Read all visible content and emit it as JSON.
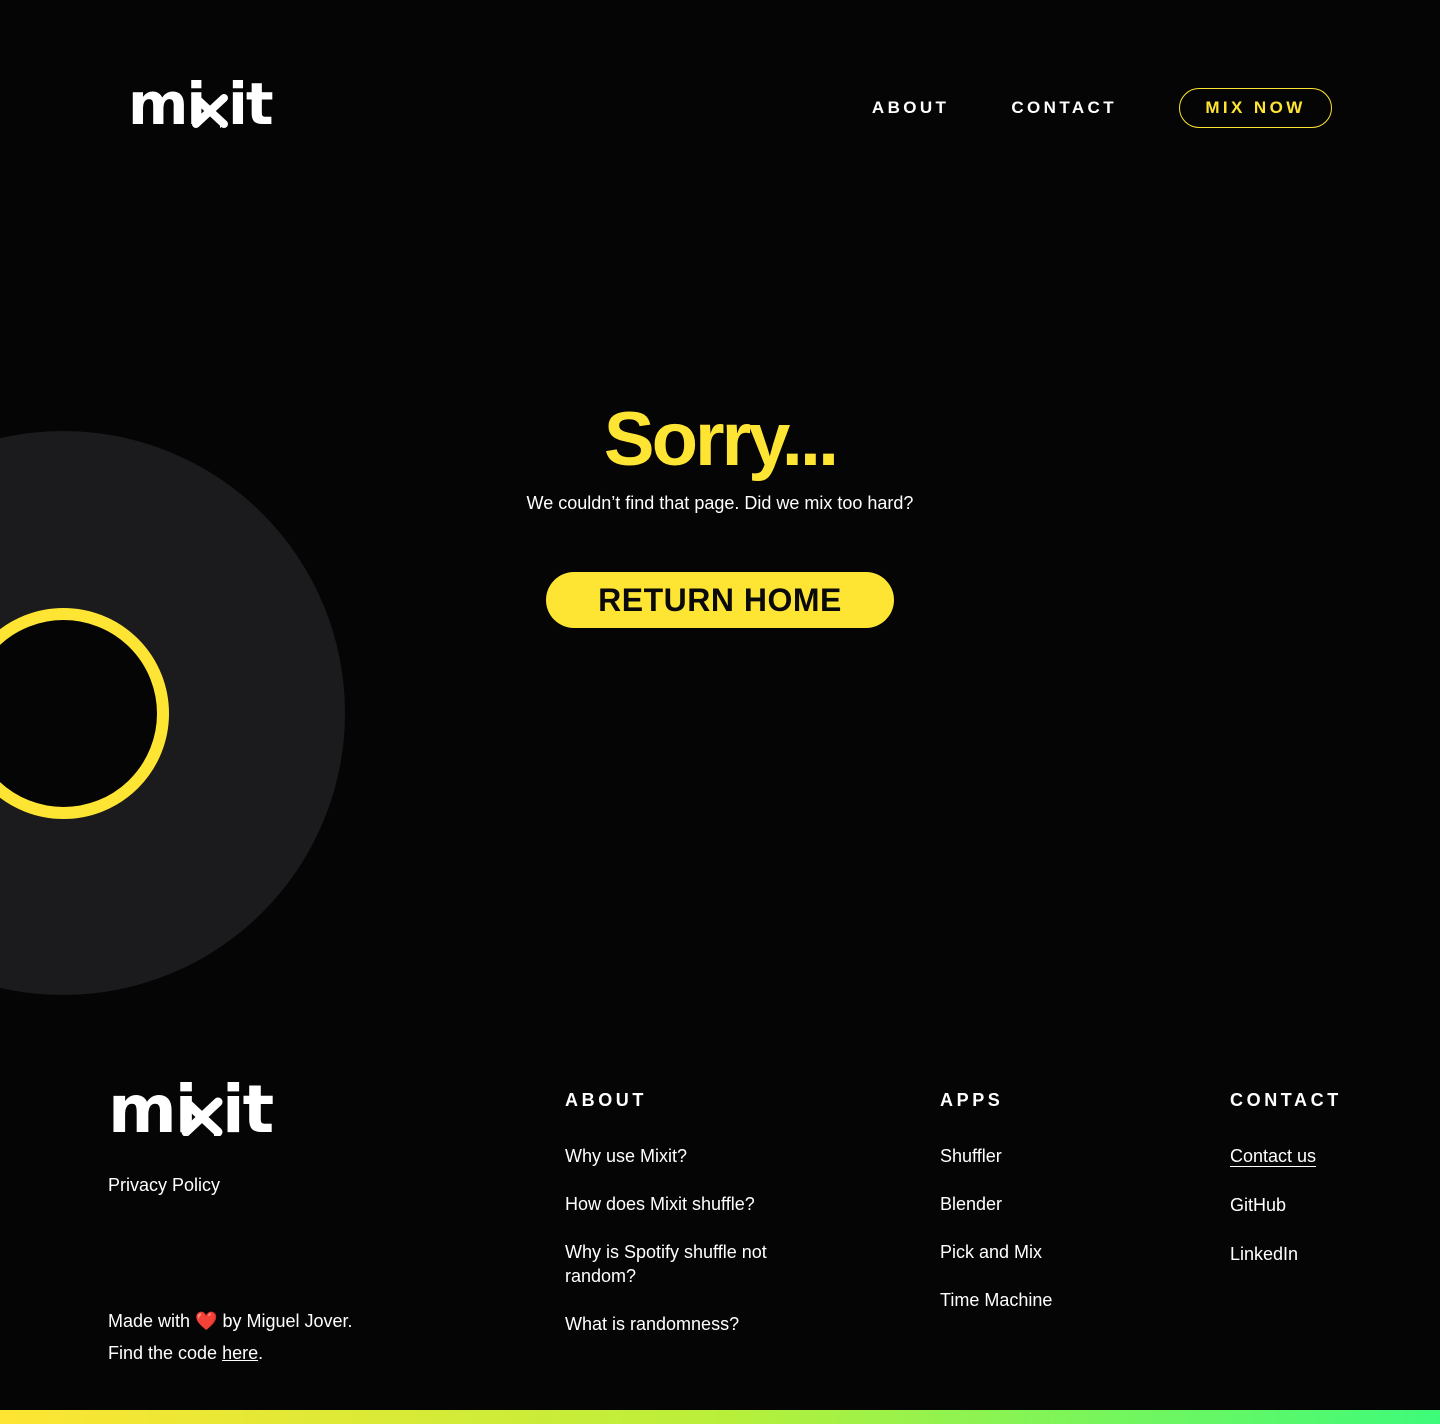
{
  "brand": {
    "name": "mixit",
    "accent": "#ffe533",
    "background": "#050505"
  },
  "header": {
    "nav": [
      {
        "label": "ABOUT"
      },
      {
        "label": "CONTACT"
      }
    ],
    "cta": "MIX NOW"
  },
  "hero": {
    "title": "Sorry...",
    "subtitle": "We couldn’t find that page. Did we mix too hard?",
    "button": "RETURN HOME"
  },
  "footer": {
    "privacy": "Privacy Policy",
    "made_with_prefix": "Made with",
    "heart": "❤️",
    "made_with_suffix": "by Miguel Jover.",
    "code_prefix": "Find the code",
    "code_link": "here",
    "code_suffix": ".",
    "columns": {
      "about": {
        "title": "ABOUT",
        "items": [
          "Why use Mixit?",
          "How does Mixit shuffle?",
          "Why is Spotify shuffle not random?",
          "What is randomness?"
        ]
      },
      "apps": {
        "title": "APPS",
        "items": [
          "Shuffler",
          "Blender",
          "Pick and Mix",
          "Time Machine"
        ]
      },
      "contact": {
        "title": "CONTACT",
        "items": [
          "Contact us",
          "GitHub",
          "LinkedIn"
        ]
      }
    }
  }
}
